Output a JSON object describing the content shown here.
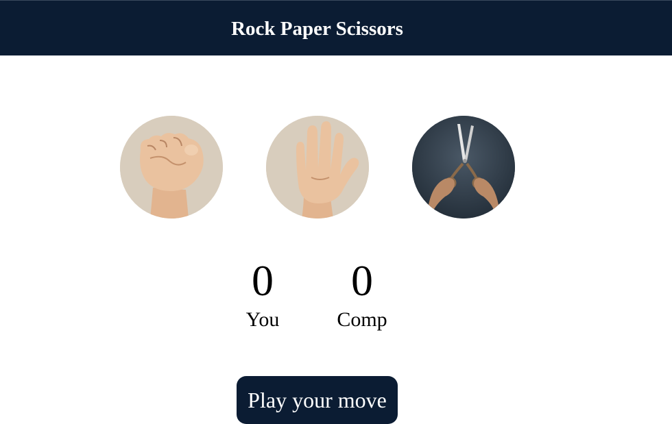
{
  "header": {
    "title": "Rock Paper Scissors"
  },
  "choices": [
    {
      "id": "rock",
      "icon": "rock-fist-icon"
    },
    {
      "id": "paper",
      "icon": "paper-hand-icon"
    },
    {
      "id": "scissors",
      "icon": "scissors-icon"
    }
  ],
  "scores": {
    "user": {
      "value": "0",
      "label": "You"
    },
    "comp": {
      "value": "0",
      "label": "Comp"
    }
  },
  "message": {
    "text": "Play your move"
  },
  "colors": {
    "header_bg": "#0b1c33",
    "message_bg": "#0b1c33",
    "choice_bg_light": "#d8cdbd",
    "choice_bg_dark": "#2e3a47"
  }
}
